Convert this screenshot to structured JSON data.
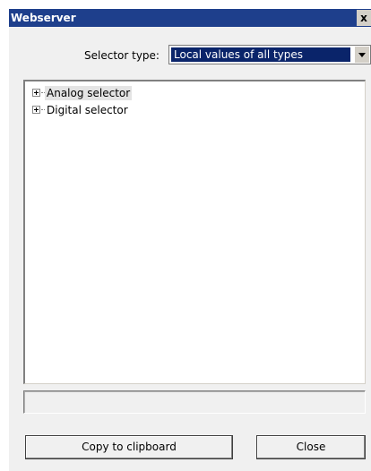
{
  "window": {
    "title": "Webserver",
    "close_glyph": "x"
  },
  "selector": {
    "label": "Selector type:",
    "selected_value": "Local values of all types"
  },
  "tree": {
    "items": [
      {
        "label": "Analog selector",
        "expanded": false,
        "selected": true
      },
      {
        "label": "Digital selector",
        "expanded": false,
        "selected": false
      }
    ]
  },
  "status": {
    "text": ""
  },
  "buttons": {
    "copy_label": "Copy to clipboard",
    "close_label": "Close"
  },
  "colors": {
    "titlebar": "#1e3f8c",
    "selection_highlight": "#0a246a",
    "dialog_background": "#f0f0f0"
  }
}
